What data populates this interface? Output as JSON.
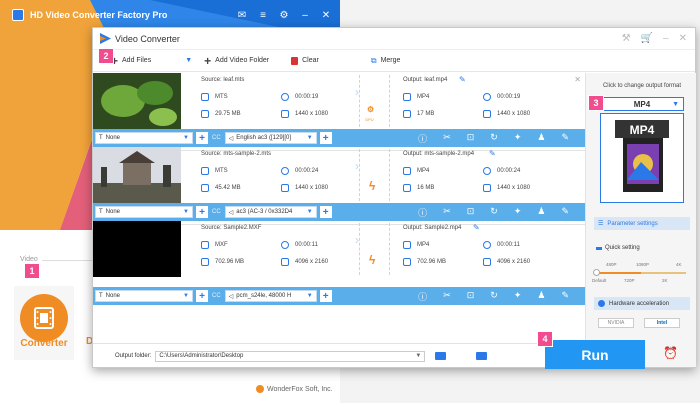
{
  "launcher": {
    "title": "HD Video Converter Factory Pro",
    "section_label": "Video",
    "converter_label": "Converter",
    "next_tile_initial": "D",
    "copyright": "WonderFox Soft, Inc."
  },
  "window": {
    "title": "Video Converter"
  },
  "toolbar": {
    "add_files": "Add Files",
    "add_video_folder": "Add Video Folder",
    "clear": "Clear",
    "merge": "Merge"
  },
  "files": [
    {
      "source": "Source: leaf.mts",
      "in_format": "MTS",
      "in_duration": "00:00:19",
      "in_size": "29.75 MB",
      "in_res": "1440 x 1080",
      "output": "Output: leaf.mp4",
      "out_format": "MP4",
      "out_duration": "00:00:19",
      "out_size": "17 MB",
      "out_res": "1440 x 1080",
      "subtitle": "None",
      "audio": "English ac3 ([129][0]",
      "convert_badge": "GPU"
    },
    {
      "source": "Source: mts-sample-2.mts",
      "in_format": "MTS",
      "in_duration": "00:00:24",
      "in_size": "45.42 MB",
      "in_res": "1440 x 1080",
      "output": "Output: mts-sample-2.mp4",
      "out_format": "MP4",
      "out_duration": "00:00:24",
      "out_size": "16 MB",
      "out_res": "1440 x 1080",
      "subtitle": "None",
      "audio": "ac3 (AC-3 / 0x332D4"
    },
    {
      "source": "Source: Sample2.MXF",
      "in_format": "MXF",
      "in_duration": "00:00:11",
      "in_size": "702.96 MB",
      "in_res": "4096 x 2160",
      "output": "Output: Sample2.mp4",
      "out_format": "MP4",
      "out_duration": "00:00:11",
      "out_size": "702.96 MB",
      "out_res": "4096 x 2160",
      "subtitle": "None",
      "audio": "pcm_s24le, 48000 H"
    }
  ],
  "side_panel": {
    "hint": "Click to change output format",
    "format": "MP4",
    "format_icon_text": "MP4",
    "parameter_settings": "Parameter settings",
    "quick_setting": "Quick setting",
    "ticks_top": [
      "480P",
      "1080P",
      "4K"
    ],
    "ticks_bottom": [
      "Default",
      "720P",
      "2K"
    ],
    "hardware_acceleration": "Hardware acceleration",
    "gpu_nvidia": "NVIDIA",
    "gpu_intel": "Intel"
  },
  "bottom": {
    "output_folder_label": "Output folder:",
    "output_folder_value": "C:\\Users\\Administrator\\Desktop",
    "run": "Run"
  },
  "steps": [
    "1",
    "2",
    "3",
    "4"
  ],
  "colors": {
    "accent": "#2b79e8",
    "editbar": "#5aaee9",
    "run": "#2196f3",
    "orange": "#f08c24",
    "step_badge": "#f04c8e"
  }
}
